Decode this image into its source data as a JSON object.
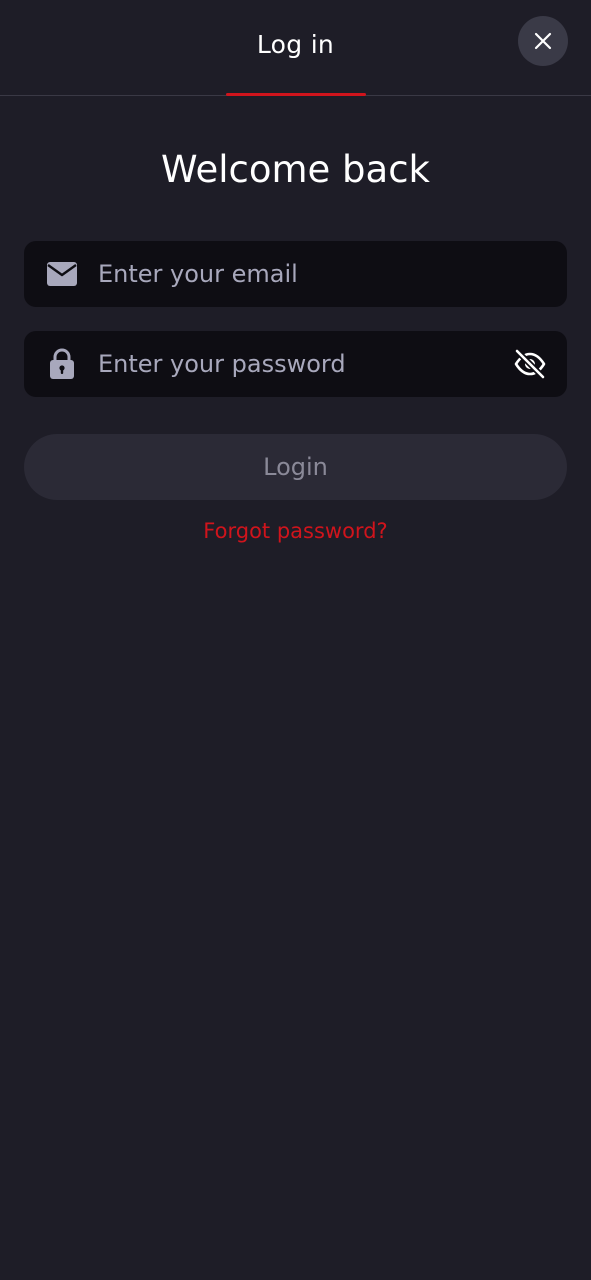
{
  "header": {
    "tab_label": "Log in",
    "close_icon": "close-icon"
  },
  "main": {
    "title": "Welcome back",
    "email": {
      "icon": "envelope-icon",
      "placeholder": "Enter your email",
      "value": ""
    },
    "password": {
      "icon": "lock-icon",
      "placeholder": "Enter your password",
      "value": "",
      "visibility_icon": "eye-off-icon"
    },
    "login_label": "Login",
    "forgot_label": "Forgot password?"
  },
  "colors": {
    "background": "#1e1d27",
    "accent": "#d0141c",
    "field_bg": "#0e0d13",
    "button_bg": "#2b2a36"
  }
}
